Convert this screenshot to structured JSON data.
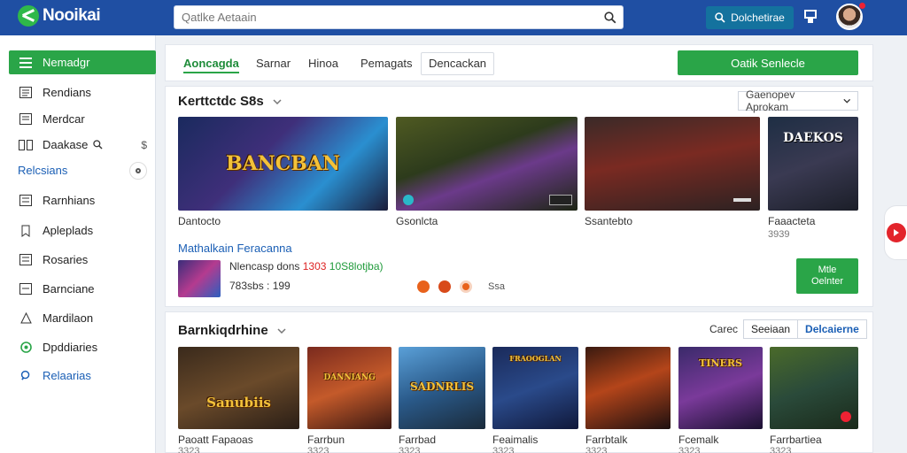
{
  "header": {
    "logo_text": "Nooikai",
    "search_placeholder": "Qatlke Aetaain",
    "action_button": "Dolchetirae"
  },
  "sidebar": {
    "items": [
      {
        "label": "Nemadgr",
        "icon": "menu-icon",
        "active": true
      },
      {
        "label": "Rendians",
        "icon": "list-icon"
      },
      {
        "label": "Merdcar",
        "icon": "list-icon"
      },
      {
        "label": "Daakase",
        "icon": "grid-icon",
        "extra": "$"
      },
      {
        "label": "Relcsians",
        "icon": "",
        "blue": true
      },
      {
        "label": "Rarnhians",
        "icon": "list-icon"
      },
      {
        "label": "Apleplads",
        "icon": "tag-icon"
      },
      {
        "label": "Rosaries",
        "icon": "list-icon"
      },
      {
        "label": "Barnciane",
        "icon": "list-icon"
      },
      {
        "label": "Mardilaon",
        "icon": "triangle-icon"
      },
      {
        "label": "Dpddiaries",
        "icon": "circle-icon"
      },
      {
        "label": "Relaarias",
        "icon": "search-icon",
        "blue": true
      }
    ]
  },
  "tabs": {
    "items": [
      "Aoncagda",
      "Sarnar",
      "Hinoa",
      "Pemagats",
      "Dencackan"
    ],
    "cta": "Oatik Senlecle"
  },
  "featured": {
    "title": "Kerttctdc S8s",
    "sort": "Gaenopev Aprokam",
    "games": [
      {
        "label": "Dantocto",
        "sub": "",
        "art": "BANCBAN"
      },
      {
        "label": "Gsonlcta",
        "sub": "",
        "art": ""
      },
      {
        "label": "Ssantebto",
        "sub": "",
        "art": ""
      },
      {
        "label": "Faaacteta",
        "sub": "3939",
        "art": "DAEKOS"
      }
    ],
    "promo": {
      "title": "Mathalkain Feracanna",
      "line1_prefix": "Nlencasp dons",
      "line1_red": "1303",
      "line1_green": "10S8lotjba)",
      "line2": "783sbs : 199",
      "tag": "Ssa",
      "button_line1": "Mtle",
      "button_line2": "Oelnter"
    }
  },
  "section2": {
    "title": "Barnkiqdrhine",
    "cats_label": "Carec",
    "seg_off": "Seeiaan",
    "seg_on": "Delcaierne",
    "games": [
      {
        "label": "Paoatt Fapaoas",
        "sub": "3323",
        "art": "Sanubiis"
      },
      {
        "label": "Farrbun",
        "sub": "3323",
        "art": "DANNIANG"
      },
      {
        "label": "Farrbad",
        "sub": "3323",
        "art": "SADNRLIS"
      },
      {
        "label": "Feaimalis",
        "sub": "3323",
        "art": "FRAOOGLAN"
      },
      {
        "label": "Farrbtalk",
        "sub": "3323",
        "art": ""
      },
      {
        "label": "Fcemalk",
        "sub": "3323",
        "art": "TINERS"
      },
      {
        "label": "Farrbartiea",
        "sub": "3323",
        "art": ""
      }
    ]
  }
}
